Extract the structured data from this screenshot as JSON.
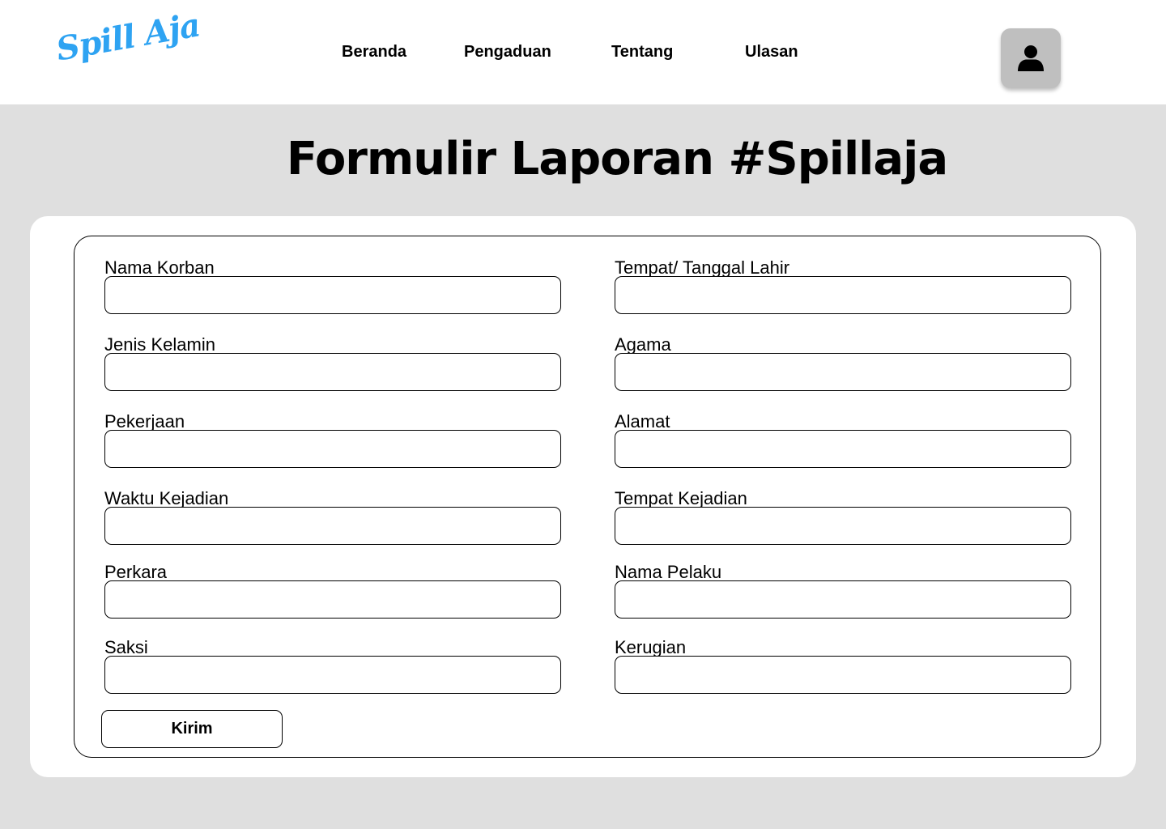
{
  "header": {
    "logo_text": "Spill Aja",
    "nav": [
      {
        "label": "Beranda"
      },
      {
        "label": "Pengaduan"
      },
      {
        "label": "Tentang"
      },
      {
        "label": "Ulasan"
      }
    ],
    "avatar_icon": "user-icon"
  },
  "page": {
    "title": "Formulir Laporan #Spillaja"
  },
  "form": {
    "fields": [
      {
        "label": "Nama Korban",
        "value": "",
        "placeholder": ""
      },
      {
        "label": "Tempat/ Tanggal Lahir",
        "value": "",
        "placeholder": ""
      },
      {
        "label": "Jenis Kelamin",
        "value": "",
        "placeholder": ""
      },
      {
        "label": "Agama",
        "value": "",
        "placeholder": ""
      },
      {
        "label": "Pekerjaan",
        "value": "",
        "placeholder": ""
      },
      {
        "label": "Alamat",
        "value": "",
        "placeholder": ""
      },
      {
        "label": "Waktu Kejadian",
        "value": "",
        "placeholder": ""
      },
      {
        "label": "Tempat Kejadian",
        "value": "",
        "placeholder": ""
      },
      {
        "label": "Perkara",
        "value": "",
        "placeholder": ""
      },
      {
        "label": "Nama Pelaku",
        "value": "",
        "placeholder": ""
      },
      {
        "label": "Saksi",
        "value": "",
        "placeholder": ""
      },
      {
        "label": "Kerugian",
        "value": "",
        "placeholder": ""
      }
    ],
    "submit_label": "Kirim"
  },
  "colors": {
    "brand": "#2ea3f2",
    "background": "#dfdfdf",
    "avatar_bg": "#bfbfbf"
  }
}
